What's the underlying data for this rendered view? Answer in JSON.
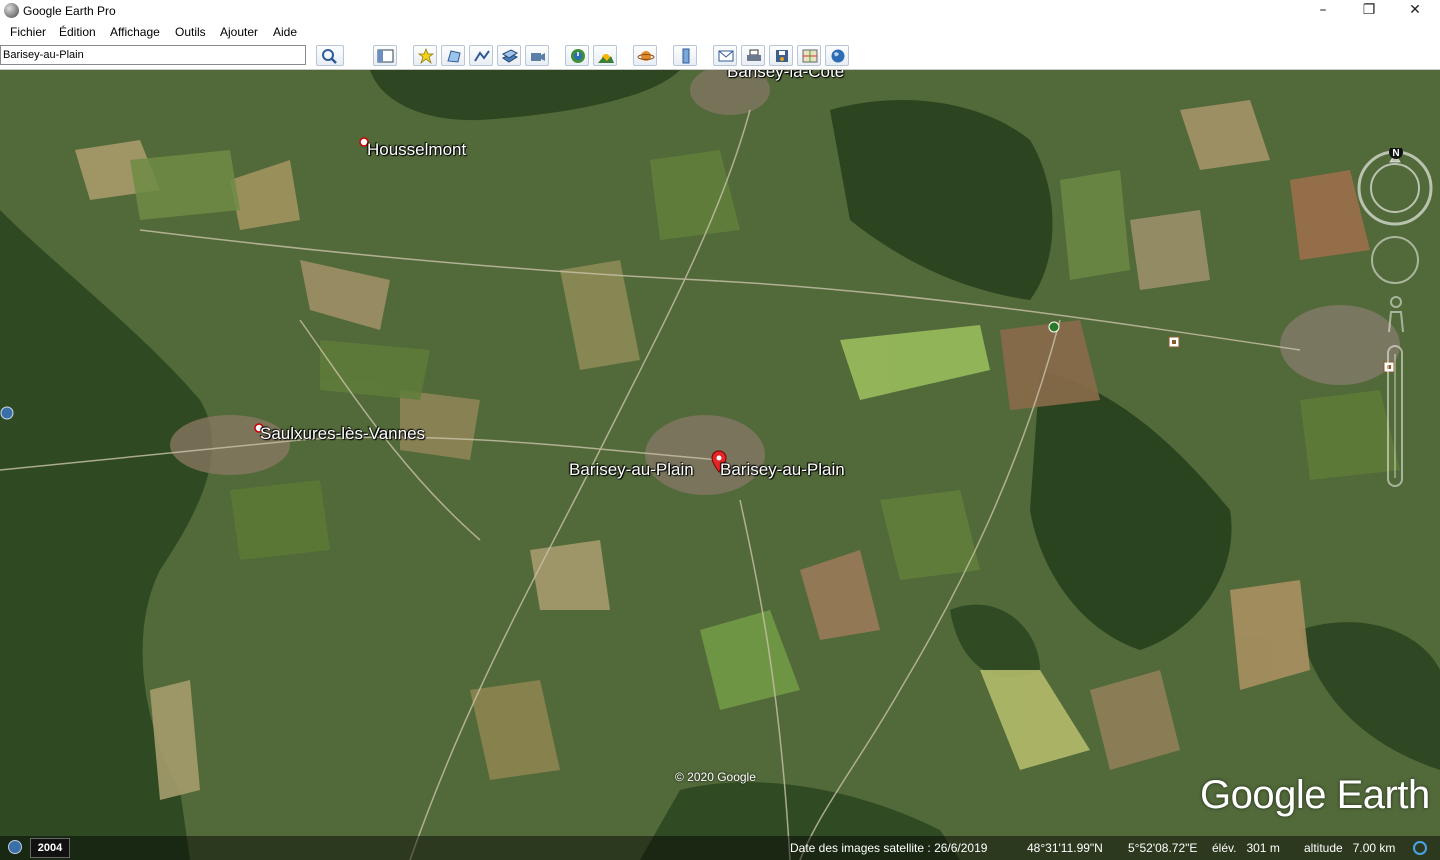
{
  "window": {
    "title": "Google Earth Pro",
    "controls": [
      "–",
      "❐",
      "✕"
    ]
  },
  "menu": {
    "items": [
      "Fichier",
      "Édition",
      "Affichage",
      "Outils",
      "Ajouter",
      "Aide"
    ]
  },
  "search": {
    "value": "Barisey-au-Plain"
  },
  "toolbar": {
    "icons": [
      "search-icon",
      "sidebar-toggle-icon",
      "placemark-icon",
      "polygon-icon",
      "path-icon",
      "overlay-icon",
      "tour-icon",
      "history-icon",
      "sunlight-icon",
      "planets-icon",
      "ruler-icon",
      "email-icon",
      "print-icon",
      "save-image-icon",
      "maps-icon",
      "earth-icon"
    ]
  },
  "map": {
    "places": [
      {
        "name": "Barisey-la-Côte"
      },
      {
        "name": "Housselmont"
      },
      {
        "name": "Saulxures-lès-Vannes"
      },
      {
        "name": "Barisey-au-Plain"
      },
      {
        "name": "Barisey-au-Plain"
      }
    ],
    "copyright": "© 2020 Google",
    "logo": "Google Earth",
    "compass_letter": "N"
  },
  "status": {
    "year": "2004",
    "imagery_date": "Date des images satellite : 26/6/2019",
    "latitude": "48°31'11.99\"N",
    "longitude": "5°52'08.72\"E",
    "elevation": "élév.   301 m",
    "altitude": "altitude   7.00 km"
  },
  "colors": {
    "map_base": "#4b6434",
    "forest": "#2f4a22",
    "field_light": "#a39a6a",
    "field_green": "#6f8a45"
  }
}
